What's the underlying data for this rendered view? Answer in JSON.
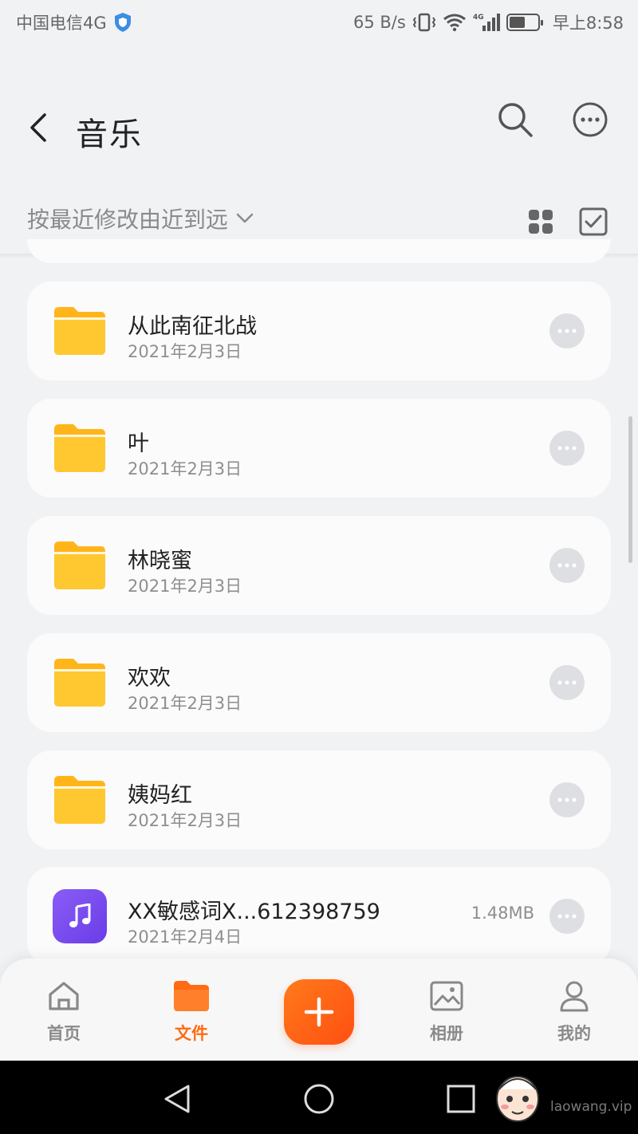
{
  "status_bar": {
    "carrier": "中国电信4G",
    "net_speed": "65 B/s",
    "net_type": "4G",
    "time": "早上8:58",
    "battery_level": 0.55,
    "icons": [
      "shield-icon",
      "vibrate-icon",
      "wifi-icon",
      "signal-icon",
      "battery-icon"
    ]
  },
  "header": {
    "title": "音乐",
    "back_icon": "chevron-left-icon",
    "search_icon": "search-icon",
    "more_icon": "more-horizontal-icon"
  },
  "sort_bar": {
    "sort_label": "按最近修改由近到远",
    "sort_icon": "chevron-down-icon",
    "view_icon": "grid-view-icon",
    "select_icon": "select-checkbox-icon"
  },
  "items": [
    {
      "name": "从此南征北战",
      "date": "2021年2月3日",
      "type": "folder",
      "size": ""
    },
    {
      "name": "叶",
      "date": "2021年2月3日",
      "type": "folder",
      "size": ""
    },
    {
      "name": "林晓蜜",
      "date": "2021年2月3日",
      "type": "folder",
      "size": ""
    },
    {
      "name": "欢欢",
      "date": "2021年2月3日",
      "type": "folder",
      "size": ""
    },
    {
      "name": "姨妈红",
      "date": "2021年2月3日",
      "type": "folder",
      "size": ""
    },
    {
      "name": "XX敏感词X...612398759",
      "date": "2021年2月4日",
      "type": "audio",
      "size": "1.48MB"
    }
  ],
  "bottom_nav": {
    "items": [
      {
        "label": "首页",
        "icon": "home-icon",
        "active": false
      },
      {
        "label": "文件",
        "icon": "folder-icon",
        "active": true
      },
      {
        "label": "相册",
        "icon": "image-icon",
        "active": false
      },
      {
        "label": "我的",
        "icon": "user-icon",
        "active": false
      }
    ],
    "add_icon": "plus-icon",
    "active_color": "#ff6a13"
  },
  "system_nav": {
    "watermark": "laowang.vip"
  },
  "colors": {
    "accent": "#ff6a13",
    "folder": "#ffc21f",
    "audio": "#7b4ff0",
    "background": "#f1f2f4",
    "card": "#fbfbfc"
  }
}
